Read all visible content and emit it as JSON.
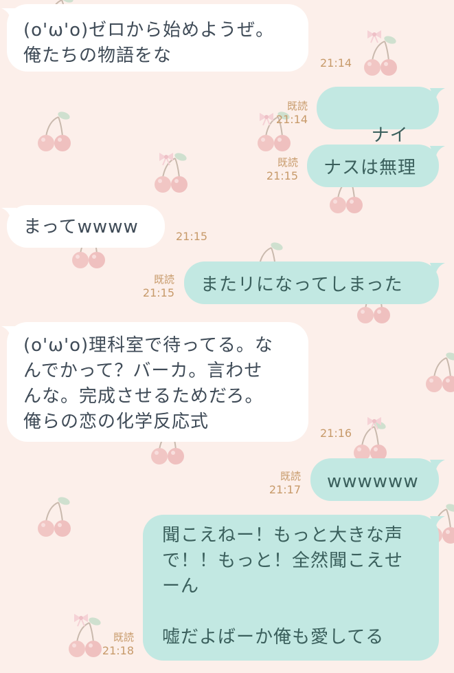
{
  "colors": {
    "background": "#fcefea",
    "incoming_bubble": "#ffffff",
    "outgoing_bubble": "#c2e8e2",
    "incoming_text": "#3f4b57",
    "outgoing_text": "#3a5f5c",
    "meta_text": "#c79a6a"
  },
  "messages": [
    {
      "direction": "incoming",
      "text": "(o'ω'o)ゼロから始めようぜ。\n俺たちの物語をな",
      "time": "21:14"
    },
    {
      "direction": "outgoing",
      "text": "ナイス",
      "emoji": "ok-hand-icon",
      "read": "既読",
      "time": "21:14"
    },
    {
      "direction": "outgoing",
      "text": "ナスは無理",
      "read": "既読",
      "time": "21:15"
    },
    {
      "direction": "incoming",
      "text": "まってwwww",
      "time": "21:15"
    },
    {
      "direction": "outgoing",
      "text": "またリになってしまった",
      "read": "既読",
      "time": "21:15"
    },
    {
      "direction": "incoming",
      "text": "(o'ω'o)理科室で待ってる。な\nんでかって？バーカ。言わせ\nんな。完成させるためだろ。\n俺らの恋の化学反応式",
      "time": "21:16"
    },
    {
      "direction": "outgoing",
      "text": "wwwwww",
      "read": "既読",
      "time": "21:17"
    },
    {
      "direction": "outgoing",
      "text": "聞こえねー！もっと大きな声\nで！！もっと！全然聞こえせ\nーん\n\n嘘だよばーか俺も愛してる",
      "read": "既読",
      "time": "21:18"
    }
  ]
}
